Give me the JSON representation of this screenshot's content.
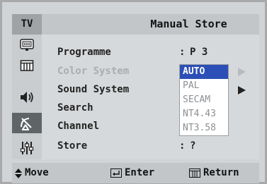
{
  "header": {
    "tab": "TV",
    "title": "Manual Store"
  },
  "sidebar": {
    "icons": [
      "picture-icon",
      "sound-icon",
      "speaker-icon",
      "channel-antenna-icon",
      "setup-sliders-icon"
    ],
    "active": "channel-antenna-icon"
  },
  "menu": {
    "rows": [
      {
        "label": "Programme",
        "value": "P 3",
        "enabled": true
      },
      {
        "label": "Color System",
        "value": "",
        "enabled": false
      },
      {
        "label": "Sound System",
        "value": "",
        "enabled": true
      },
      {
        "label": "Search",
        "value": "",
        "enabled": true
      },
      {
        "label": "Channel",
        "value": "",
        "enabled": true
      },
      {
        "label": "Store",
        "value": "?",
        "enabled": true
      }
    ],
    "colon": ":"
  },
  "dropdown": {
    "options": [
      "AUTO",
      "PAL",
      "SECAM",
      "NT4.43",
      "NT3.58"
    ],
    "selected": "AUTO",
    "selected_color": "#2c4fb7"
  },
  "footer": {
    "move": "Move",
    "enter": "Enter",
    "return": "Return"
  }
}
